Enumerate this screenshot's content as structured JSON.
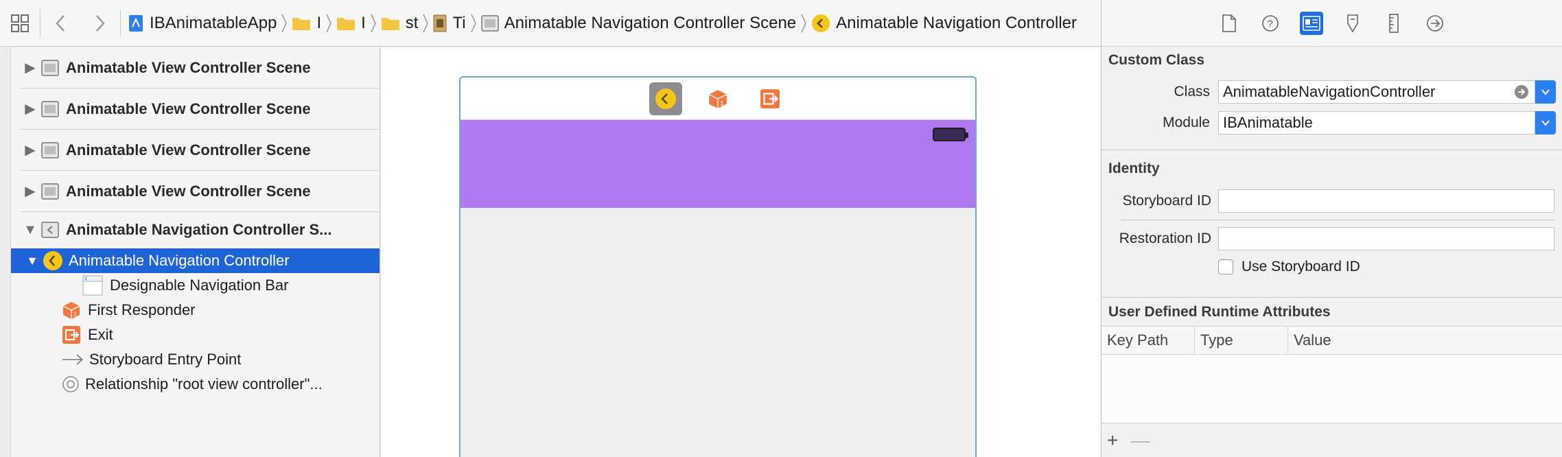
{
  "jumpbar": {
    "crumbs": [
      {
        "label": "IBAnimatableApp",
        "icon": "project-icon"
      },
      {
        "label": "I",
        "icon": "folder-icon"
      },
      {
        "label": "I",
        "icon": "folder-icon"
      },
      {
        "label": "st",
        "icon": "folder-icon"
      },
      {
        "label": "Ti",
        "icon": "storyboard-icon"
      },
      {
        "label": "Animatable Navigation Controller Scene",
        "icon": "scene-icon"
      },
      {
        "label": "Animatable Navigation Controller",
        "icon": "nav-controller-icon"
      }
    ]
  },
  "outline": {
    "scenes": [
      "Animatable View Controller Scene",
      "Animatable View Controller Scene",
      "Animatable View Controller Scene",
      "Animatable View Controller Scene",
      "Animatable Navigation Controller S..."
    ],
    "children": [
      "Animatable Navigation Controller",
      "Designable Navigation Bar",
      "First Responder",
      "Exit",
      "Storyboard Entry Point",
      "Relationship \"root view controller\"..."
    ]
  },
  "inspector": {
    "custom_class": {
      "title": "Custom Class",
      "class_label": "Class",
      "class_value": "AnimatableNavigationController",
      "module_label": "Module",
      "module_value": "IBAnimatable"
    },
    "identity": {
      "title": "Identity",
      "storyboard_id_label": "Storyboard ID",
      "storyboard_id_value": "",
      "restoration_id_label": "Restoration ID",
      "restoration_id_value": "",
      "use_storyboard_id_label": "Use Storyboard ID",
      "use_storyboard_id_checked": false
    },
    "runtime_attributes": {
      "title": "User Defined Runtime Attributes",
      "columns": [
        "Key Path",
        "Type",
        "Value"
      ],
      "add_label": "+",
      "remove_label": "—"
    }
  },
  "colors": {
    "selection": "#1f64d7",
    "navbar": "#b078f0",
    "accent": "#2b7ff1",
    "nav_controller_icon": "#f5c518",
    "responder_icon": "#f07840"
  }
}
